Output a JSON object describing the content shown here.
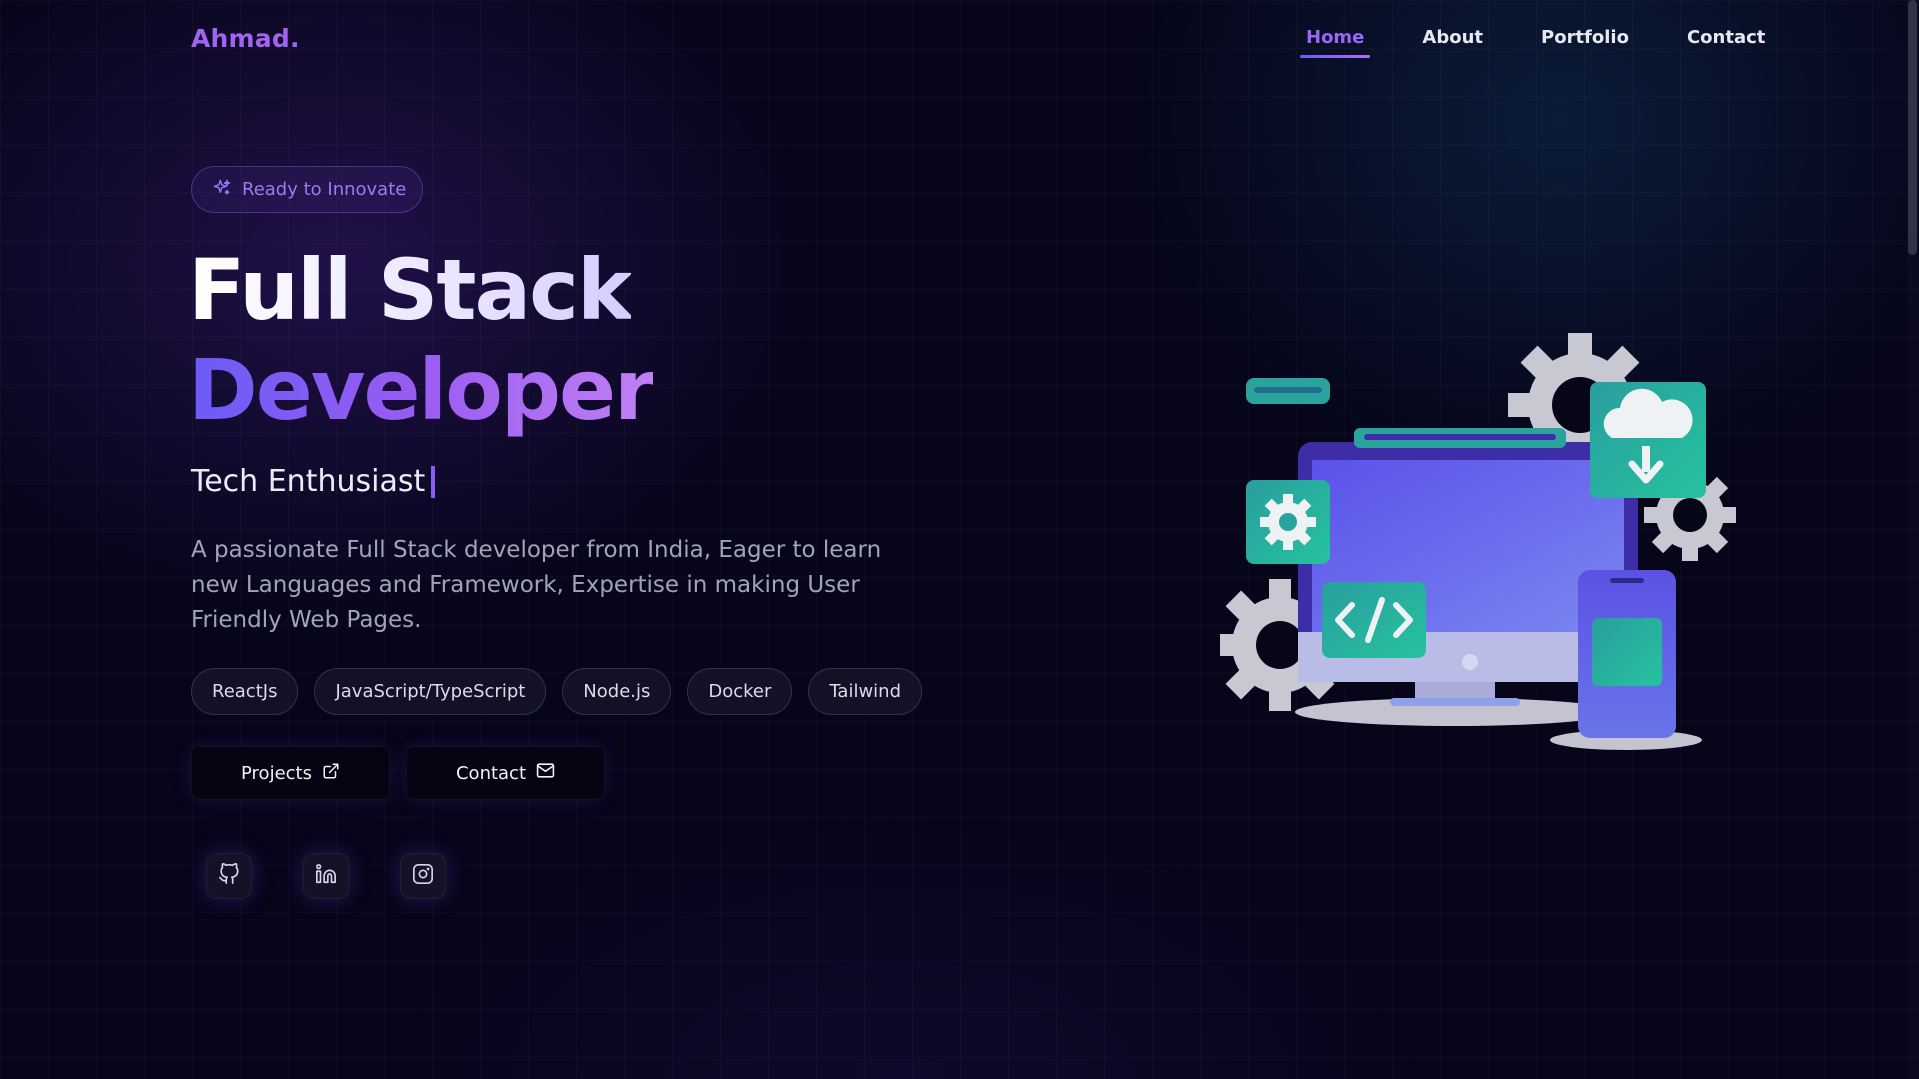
{
  "nav": {
    "logo": "Ahmad.",
    "items": [
      {
        "label": "Home",
        "active": true
      },
      {
        "label": "About",
        "active": false
      },
      {
        "label": "Portfolio",
        "active": false
      },
      {
        "label": "Contact",
        "active": false
      }
    ]
  },
  "hero": {
    "badge": "Ready to Innovate",
    "title_line1": "Full Stack",
    "title_line2": "Developer",
    "subtitle": "Tech Enthusiast",
    "description": "A passionate Full Stack developer from India, Eager to learn new Languages and Framework, Expertise in making User Friendly Web Pages.",
    "chips": [
      "ReactJs",
      "JavaScript/TypeScript",
      "Node.js",
      "Docker",
      "Tailwind"
    ],
    "buttons": {
      "projects_label": "Projects",
      "projects_icon": "external-link-icon",
      "contact_label": "Contact",
      "contact_icon": "mail-icon"
    },
    "socials": [
      "github-icon",
      "linkedin-icon",
      "instagram-icon"
    ]
  },
  "colors": {
    "accent": "#9b66f5",
    "background": "#06051a",
    "teal": "#2bb5a8"
  }
}
